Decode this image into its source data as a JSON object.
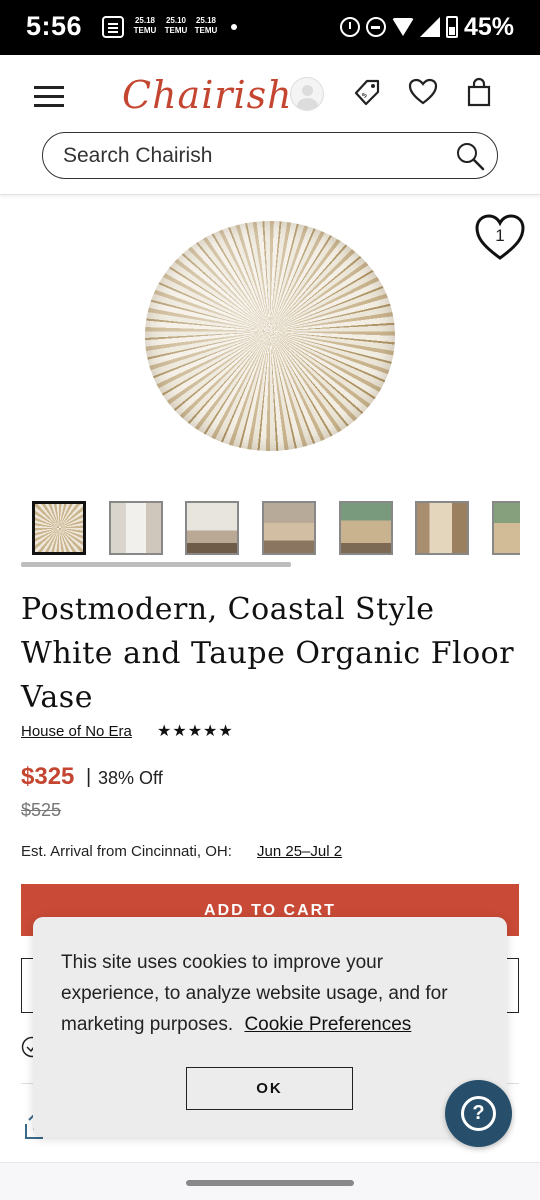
{
  "status_bar": {
    "time": "5:56",
    "notifications": [
      {
        "line1": "25.18",
        "line2": "TEMU"
      },
      {
        "line1": "25.10",
        "line2": "TEMU"
      },
      {
        "line1": "25.18",
        "line2": "TEMU"
      }
    ],
    "battery": "45%"
  },
  "header": {
    "logo": "Chairish",
    "search_placeholder": "Search Chairish"
  },
  "product": {
    "favorite_count": "1",
    "title": "Postmodern, Coastal Style White and Taupe Organic Floor Vase",
    "seller": "House of No Era",
    "rating_stars": "★★★★★",
    "rating_value": 5,
    "price": "$325",
    "price_separator": "|",
    "discount": "38% Off",
    "original_price": "$525",
    "arrival_label": "Est. Arrival from Cincinnati, OH:",
    "arrival_dates": "Jun 25–Jul 2",
    "add_to_cart": "ADD TO CART",
    "thumbnail_count": 7,
    "active_thumbnail": 1
  },
  "cookie_banner": {
    "text": "This site uses cookies to improve your experience, to analyze website usage, and for marketing purposes.",
    "link": "Cookie Preferences",
    "ok": "OK"
  },
  "help": {
    "icon": "question-icon",
    "glyph": "?"
  },
  "colors": {
    "brand": "#c44530",
    "add_to_cart": "#c94a36",
    "help_button": "#274f6b",
    "status_bar": "#000000"
  }
}
